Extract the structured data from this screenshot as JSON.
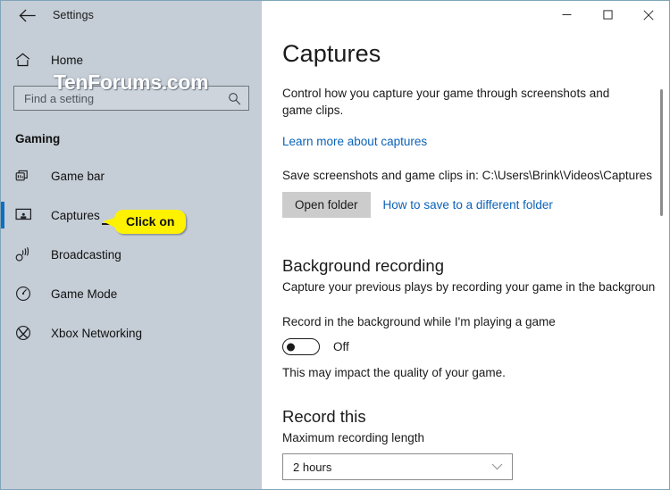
{
  "window": {
    "title": "Settings",
    "back_icon": "back-arrow-icon",
    "controls": {
      "minimize": "minimize-icon",
      "maximize": "maximize-icon",
      "close": "close-icon"
    }
  },
  "sidebar": {
    "home": {
      "label": "Home",
      "icon": "home-icon"
    },
    "search": {
      "placeholder": "Find a setting",
      "icon": "search-icon"
    },
    "watermark": "TenForums.com",
    "section_header": "Gaming",
    "items": [
      {
        "label": "Game bar",
        "icon": "game-bar-icon",
        "selected": false
      },
      {
        "label": "Captures",
        "icon": "captures-icon",
        "selected": true
      },
      {
        "label": "Broadcasting",
        "icon": "broadcasting-icon",
        "selected": false
      },
      {
        "label": "Game Mode",
        "icon": "game-mode-icon",
        "selected": false
      },
      {
        "label": "Xbox Networking",
        "icon": "xbox-icon",
        "selected": false
      }
    ],
    "accent_color": "#0d6fc2",
    "background_color": "#c5cdd6"
  },
  "callout": {
    "text": "Click on",
    "background_color": "#fff200"
  },
  "main": {
    "title": "Captures",
    "description": "Control how you capture your game through screenshots and game clips.",
    "learn_more_link": "Learn more about captures",
    "save_location_line": "Save screenshots and game clips in: C:\\Users\\Brink\\Videos\\Captures",
    "open_folder_button": "Open folder",
    "different_folder_link": "How to save to a different folder",
    "background_recording": {
      "heading": "Background recording",
      "description": "Capture your previous plays by recording your game in the background.",
      "toggle_label": "Record in the background while I'm playing a game",
      "toggle_state": "Off",
      "note": "This may impact the quality of your game."
    },
    "record_this": {
      "heading": "Record this",
      "field_label": "Maximum recording length",
      "selected_option": "2 hours"
    },
    "link_color": "#0b62b8"
  }
}
